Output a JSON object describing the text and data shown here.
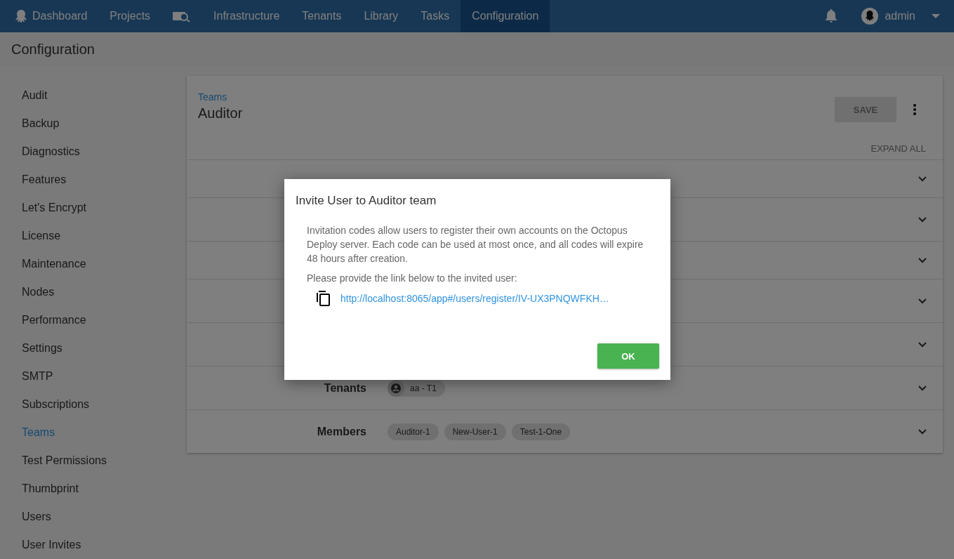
{
  "nav": {
    "items": [
      {
        "kind": "logo",
        "label": "Dashboard",
        "selected": false
      },
      {
        "kind": "text",
        "label": "Projects",
        "selected": false
      },
      {
        "kind": "icon",
        "selected": false
      },
      {
        "kind": "text",
        "label": "Infrastructure",
        "selected": false
      },
      {
        "kind": "text",
        "label": "Tenants",
        "selected": false
      },
      {
        "kind": "text",
        "label": "Library",
        "selected": false
      },
      {
        "kind": "text",
        "label": "Tasks",
        "selected": false
      },
      {
        "kind": "text",
        "label": "Configuration",
        "selected": true
      }
    ],
    "user": "admin"
  },
  "page_title": "Configuration",
  "sidebar": {
    "items": [
      {
        "label": "Audit",
        "selected": false
      },
      {
        "label": "Backup",
        "selected": false
      },
      {
        "label": "Diagnostics",
        "selected": false
      },
      {
        "label": "Features",
        "selected": false
      },
      {
        "label": "Let's Encrypt",
        "selected": false
      },
      {
        "label": "License",
        "selected": false
      },
      {
        "label": "Maintenance",
        "selected": false
      },
      {
        "label": "Nodes",
        "selected": false
      },
      {
        "label": "Performance",
        "selected": false
      },
      {
        "label": "Settings",
        "selected": false
      },
      {
        "label": "SMTP",
        "selected": false
      },
      {
        "label": "Subscriptions",
        "selected": false
      },
      {
        "label": "Teams",
        "selected": true
      },
      {
        "label": "Test Permissions",
        "selected": false
      },
      {
        "label": "Thumbprint",
        "selected": false
      },
      {
        "label": "Users",
        "selected": false
      },
      {
        "label": "User Invites",
        "selected": false
      }
    ]
  },
  "card": {
    "breadcrumb": "Teams",
    "title": "Auditor",
    "save_button": {
      "label": "SAVE",
      "disabled": true
    },
    "expand_all": "EXPAND ALL",
    "sections": [
      {
        "expanded": false
      },
      {
        "expanded": false
      },
      {
        "expanded": false
      },
      {
        "expanded": false
      },
      {
        "expanded": false
      },
      {
        "label": "Tenants",
        "expanded": false,
        "chips": [
          {
            "kind": "tenant",
            "text": "aa - T1"
          }
        ]
      },
      {
        "label": "Members",
        "expanded": false,
        "chips": [
          {
            "kind": "plain",
            "text": "Auditor-1"
          },
          {
            "kind": "plain",
            "text": "New-User-1"
          },
          {
            "kind": "plain",
            "text": "Test-1-One"
          }
        ]
      }
    ]
  },
  "dialog": {
    "title": "Invite User to Auditor team",
    "paragraphs": [
      "Invitation codes allow users to register their own accounts on the Octopus Deploy server. Each code can be used at most once, and all codes will expire 48 hours after creation.",
      "Please provide the link below to the invited user:"
    ],
    "link": "http://localhost:8065/app#/users/register/IV-UX3PNQWFKH…",
    "ok_button": "OK"
  }
}
